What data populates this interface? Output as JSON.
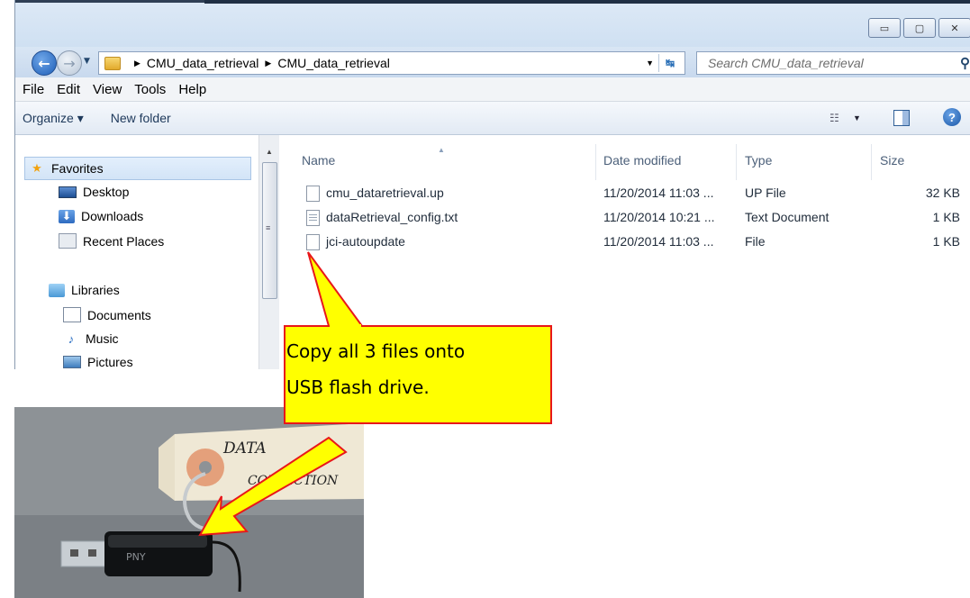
{
  "window": {
    "controls": {
      "minimize": "▭",
      "maximize": "▢",
      "close": "✕"
    }
  },
  "navigation": {
    "breadcrumb": [
      "CMU_data_retrieval",
      "CMU_data_retrieval"
    ],
    "search_placeholder": "Search CMU_data_retrieval"
  },
  "menu": [
    "File",
    "Edit",
    "View",
    "Tools",
    "Help"
  ],
  "toolbar": {
    "organize": "Organize ▾",
    "new_folder": "New folder"
  },
  "sidebar": {
    "favorites": {
      "label": "Favorites",
      "items": [
        "Desktop",
        "Downloads",
        "Recent Places"
      ]
    },
    "libraries": {
      "label": "Libraries",
      "items": [
        "Documents",
        "Music",
        "Pictures"
      ]
    }
  },
  "file_list": {
    "columns": [
      "Name",
      "Date modified",
      "Type",
      "Size"
    ],
    "rows": [
      {
        "name": "cmu_dataretrieval.up",
        "date": "11/20/2014 11:03 ...",
        "type": "UP File",
        "size": "32 KB"
      },
      {
        "name": "dataRetrieval_config.txt",
        "date": "11/20/2014 10:21 ...",
        "type": "Text Document",
        "size": "1 KB"
      },
      {
        "name": "jci-autoupdate",
        "date": "11/20/2014 11:03 ...",
        "type": "File",
        "size": "1 KB"
      }
    ]
  },
  "annotation": {
    "line1": "Copy all 3 files onto",
    "line2": "USB flash drive.",
    "fill_color": "#ffff00",
    "border_color": "#e8171a"
  },
  "photo": {
    "tag_text_1": "DATA",
    "tag_text_2": "COLLECTION",
    "usb_brand": "PNY"
  }
}
